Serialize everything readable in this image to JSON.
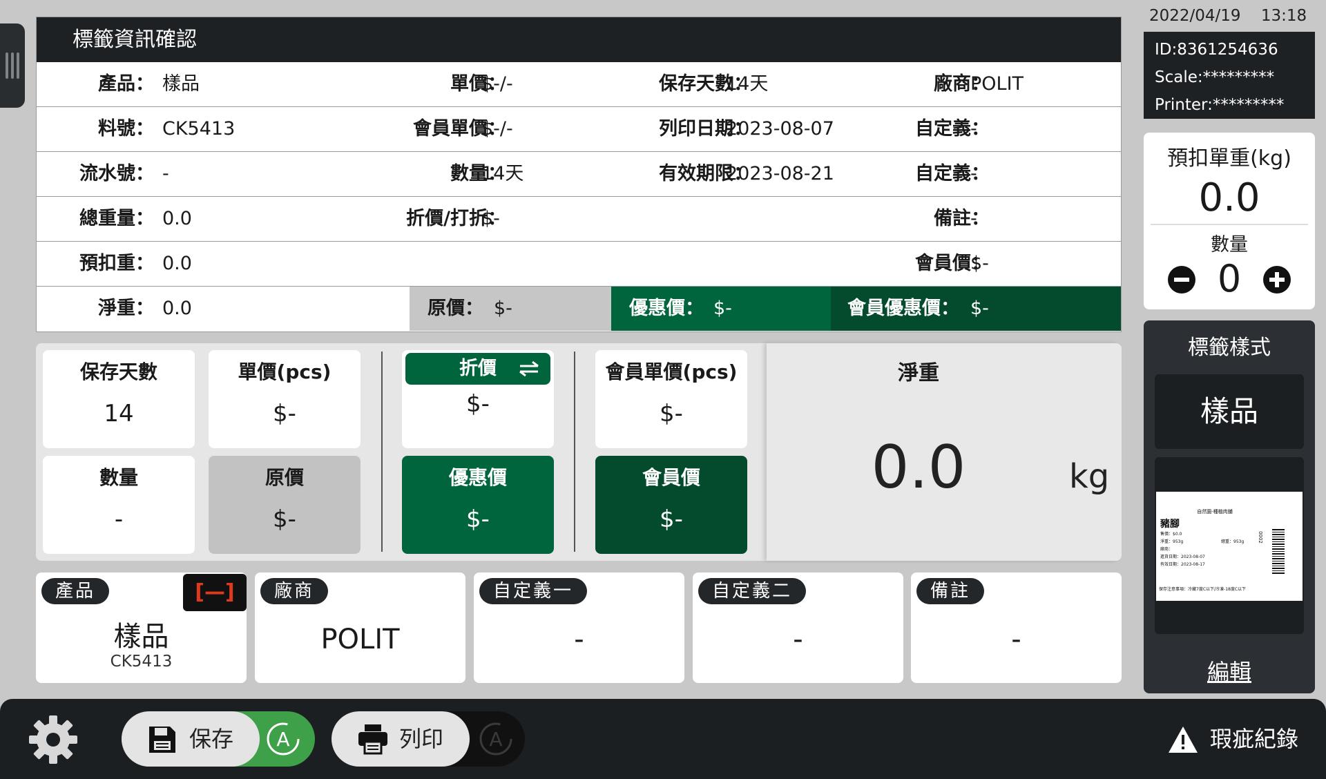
{
  "info": {
    "title": "標籤資訊確認",
    "rows": [
      [
        {
          "label": "產品：",
          "value": "樣品"
        },
        {
          "label": "單價：",
          "value": "$-/-"
        },
        {
          "label": "保存天數：",
          "value": "14天"
        },
        {
          "label": "廠商：",
          "value": "POLIT"
        }
      ],
      [
        {
          "label": "料號：",
          "value": "CK5413"
        },
        {
          "label": "會員單價：",
          "value": "$-/-"
        },
        {
          "label": "列印日期：",
          "value": "2023-08-07"
        },
        {
          "label": "自定義：",
          "value": "-"
        }
      ],
      [
        {
          "label": "流水號：",
          "value": "-"
        },
        {
          "label": "數量：",
          "value": "14天"
        },
        {
          "label": "有效期限：",
          "value": "2023-08-21"
        },
        {
          "label": "自定義：",
          "value": "-"
        }
      ],
      [
        {
          "label": "總重量：",
          "value": "0.0"
        },
        {
          "label": "折價/打折：",
          "value": "$-"
        },
        {
          "label": "",
          "value": ""
        },
        {
          "label": "備註：",
          "value": "-"
        }
      ],
      [
        {
          "label": "預扣重：",
          "value": "0.0"
        },
        {
          "label": "",
          "value": ""
        },
        {
          "label": "",
          "value": ""
        },
        {
          "label": "會員價：",
          "value": "$-"
        }
      ]
    ],
    "last_row": {
      "net_label": "淨重：",
      "net_value": "0.0",
      "orig_label": "原價：",
      "orig_value": "$-",
      "promo_label": "優惠價：",
      "promo_value": "$-",
      "member_promo_label": "會員優惠價：",
      "member_promo_value": "$-"
    }
  },
  "panel": {
    "shelf_days": {
      "label": "保存天數",
      "value": "14"
    },
    "unit_price": {
      "label": "單價(pcs)",
      "value": "$-"
    },
    "discount": {
      "label": "折價",
      "value": "$-"
    },
    "member_unit_price": {
      "label": "會員單價(pcs)",
      "value": "$-"
    },
    "quantity": {
      "label": "數量",
      "value": "-"
    },
    "original_price": {
      "label": "原價",
      "value": "$-"
    },
    "promo_price": {
      "label": "優惠價",
      "value": "$-"
    },
    "member_price": {
      "label": "會員價",
      "value": "$-"
    },
    "net_weight": {
      "label": "淨重",
      "value": "0.0",
      "unit": "kg"
    }
  },
  "bottom_cards": {
    "product": {
      "tag": "產品",
      "value": "樣品",
      "sub": "CK5413",
      "badge": "[—]"
    },
    "vendor": {
      "tag": "廠商",
      "value": "POLIT"
    },
    "custom1": {
      "tag": "自定義一",
      "value": "-"
    },
    "custom2": {
      "tag": "自定義二",
      "value": "-"
    },
    "note": {
      "tag": "備註",
      "value": "-"
    }
  },
  "status": {
    "date": "2022/04/19",
    "time": "13:18",
    "id": "ID:8361254636",
    "scale": "Scale:*********",
    "printer": "Printer:*********"
  },
  "tare": {
    "title": "預扣單重(kg)",
    "value": "0.0",
    "qty_label": "數量",
    "qty_value": "0"
  },
  "label_style": {
    "title": "標籤樣式",
    "name": "樣品",
    "edit": "編輯",
    "preview": {
      "header": "自然園-種植肉舖",
      "product": "豬腳",
      "lines": [
        "售價：$0.0",
        "淨重：953g",
        "總重：953g",
        "廠商：",
        "進貨日期：2023-08-07",
        "有效日期：2023-08-17"
      ],
      "footer": "保存注意事項：冷藏7度C以下/冷凍-18度C以下",
      "code": "0002"
    }
  },
  "toolbar": {
    "save_label": "保存",
    "print_label": "列印",
    "defect_label": "瑕疵紀錄"
  },
  "colors": {
    "green": "#00643c",
    "dark_green": "#044a2c",
    "header_dark": "#1e2124",
    "save_auto_green": "#3ea048"
  }
}
